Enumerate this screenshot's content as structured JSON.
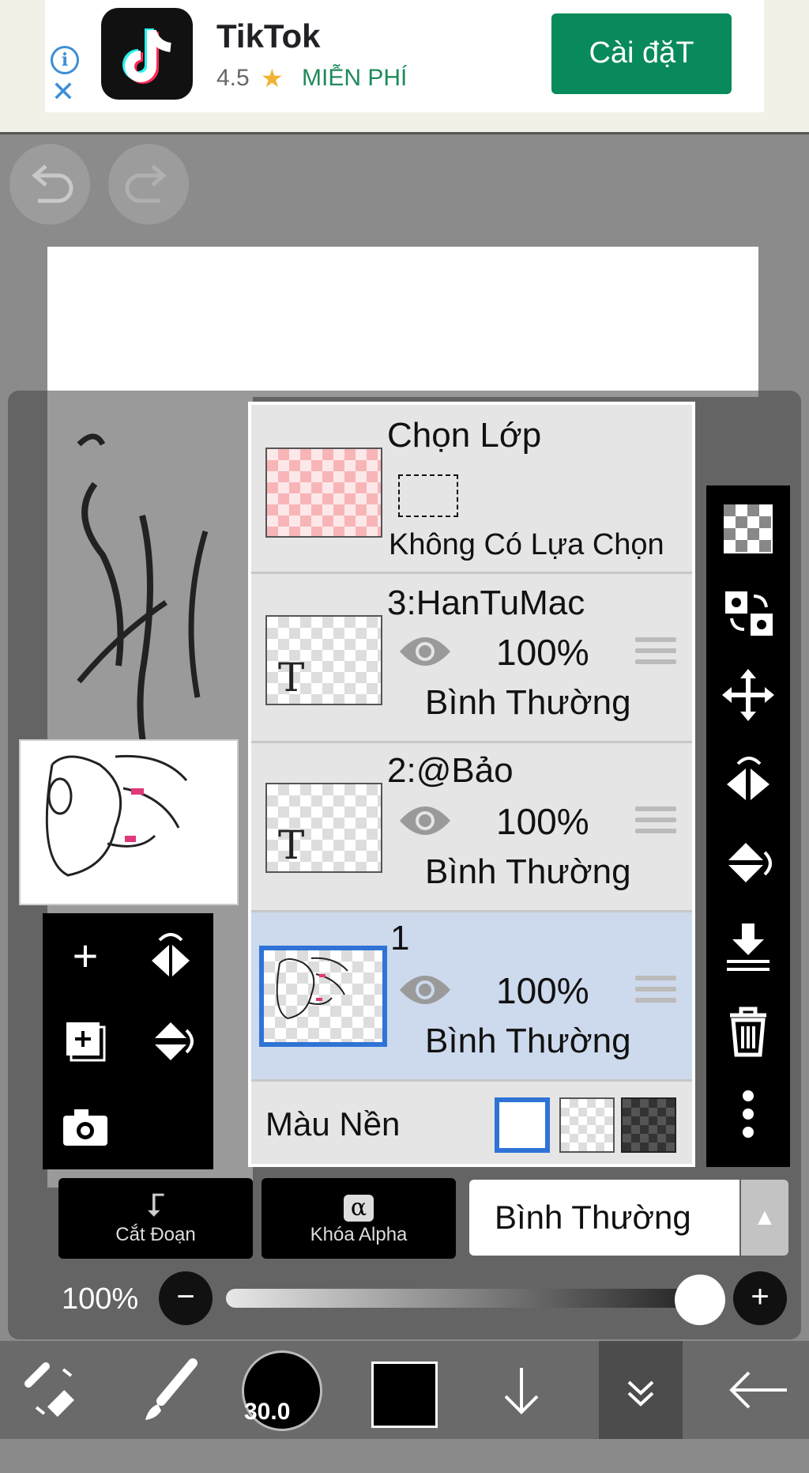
{
  "ad": {
    "app_name": "TikTok",
    "rating": "4.5",
    "star": "★",
    "price": "MIỄN PHÍ",
    "install_label": "Cài đặT",
    "info_icon": "info-icon",
    "close_icon": "close-icon"
  },
  "layers": {
    "selection": {
      "title": "Chọn Lớp",
      "subtitle": "Không Có Lựa Chọn"
    },
    "items": [
      {
        "name": "3:HanTuMac",
        "opacity": "100%",
        "mode": "Bình Thường",
        "type": "text",
        "glyph": "T"
      },
      {
        "name": "2:@Bảo",
        "opacity": "100%",
        "mode": "Bình Thường",
        "type": "text",
        "glyph": "T"
      },
      {
        "name": "1",
        "opacity": "100%",
        "mode": "Bình Thường",
        "type": "image",
        "selected": true
      }
    ],
    "background": {
      "label": "Màu Nền",
      "options": [
        "white",
        "transparent",
        "dark-checker"
      ],
      "selected": "white"
    }
  },
  "bottom": {
    "clip_label": "Cắt Đoạn",
    "alpha_lock_label": "Khóa Alpha",
    "alpha_glyph": "α",
    "blend_mode": "Bình Thường",
    "opacity_label": "100%",
    "opacity_value": 1.0
  },
  "toolbar": {
    "brush_size": "30.0",
    "color": "#000000"
  },
  "colors": {
    "accent_blue": "#2f73d6",
    "ad_install": "#088a5a",
    "selected_row": "#cdd9ec"
  }
}
